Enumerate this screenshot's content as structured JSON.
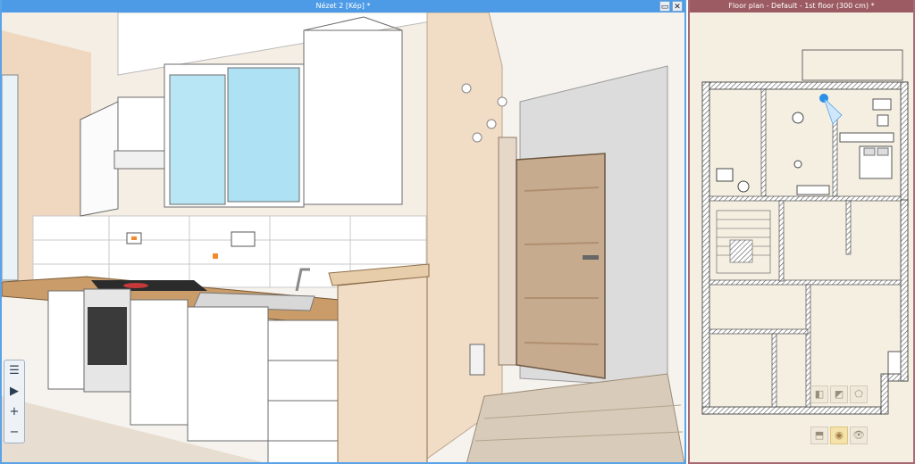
{
  "view3d": {
    "title": "Nézet 2 [Kép] *",
    "window_buttons": {
      "restore": "▭",
      "close": "✕"
    },
    "nav": {
      "list": "☰",
      "play": "▶",
      "zoom_in": "+",
      "zoom_out": "−"
    }
  },
  "floorplan": {
    "title": "Floor plan - Default - 1st floor (300 cm) *",
    "tools": {
      "t1": "◧",
      "t2": "◩",
      "t3": "⬠",
      "t4": "⬒",
      "t5": "◉",
      "t6": "👁"
    }
  },
  "colors": {
    "view_accent": "#4d9be6",
    "plan_accent": "#9c5b63"
  }
}
